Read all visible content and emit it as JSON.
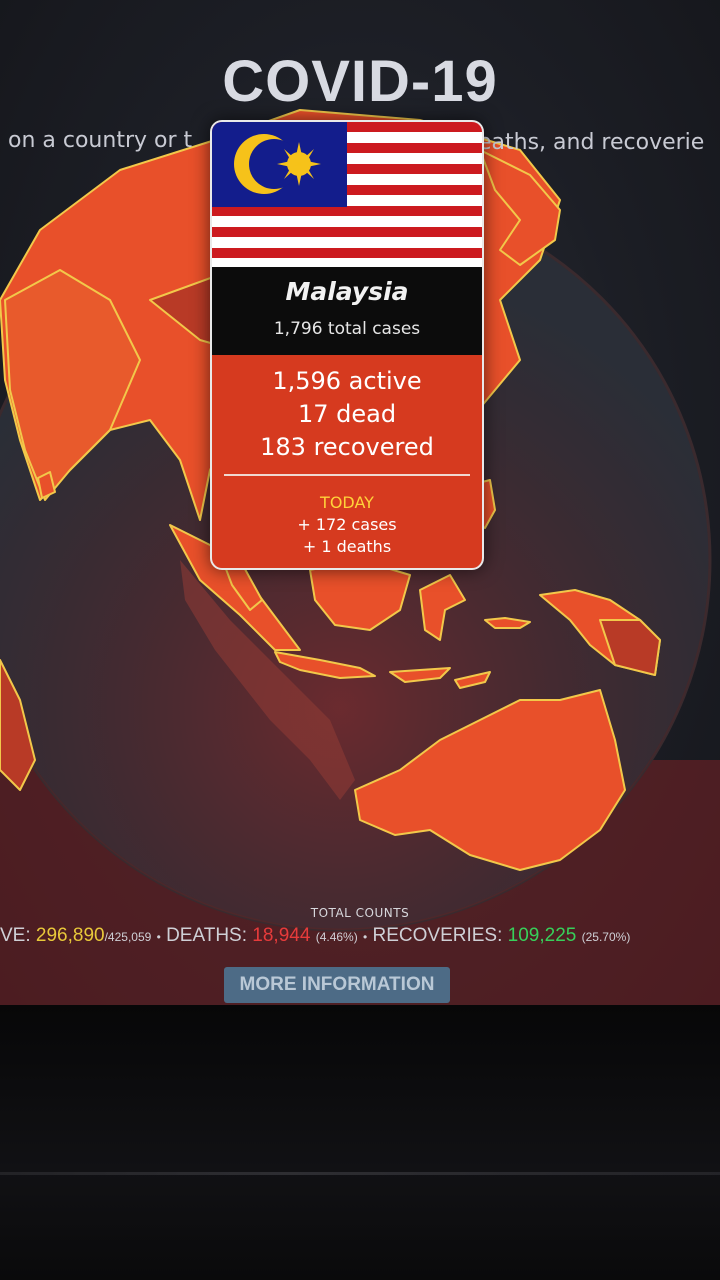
{
  "header": {
    "title": "COVID-19",
    "subtitle_left": "on a country or t",
    "subtitle_right": "eaths, and recoverie"
  },
  "popup": {
    "country": "Malaysia",
    "total_cases": "1,796 total cases",
    "active": "1,596 active",
    "dead": "17 dead",
    "recovered": "183 recovered",
    "today_label": "TODAY",
    "today_cases": "+ 172 cases",
    "today_deaths": "+ 1 deaths"
  },
  "totals": {
    "label": "TOTAL COUNTS",
    "active_label": "VE:",
    "active_value": "296,890",
    "active_total": "/425,059",
    "sep1": "•",
    "deaths_label": "DEATHS:",
    "deaths_value": "18,944",
    "deaths_pct": "(4.46%)",
    "sep2": "•",
    "recoveries_label": "RECOVERIES:",
    "recoveries_value": "109,225",
    "recoveries_pct": "(25.70%)"
  },
  "more_button": "MORE INFORMATION",
  "colors": {
    "land": "#e8502a",
    "land_dark": "#b83a26",
    "coast": "#f2c84a",
    "ocean": "#262a33",
    "popup": "#d63a1f",
    "active": "#e8c83a",
    "deaths": "#e63b3b",
    "recoveries": "#37d05a"
  },
  "icons": {
    "flag": "malaysia-flag-icon"
  }
}
